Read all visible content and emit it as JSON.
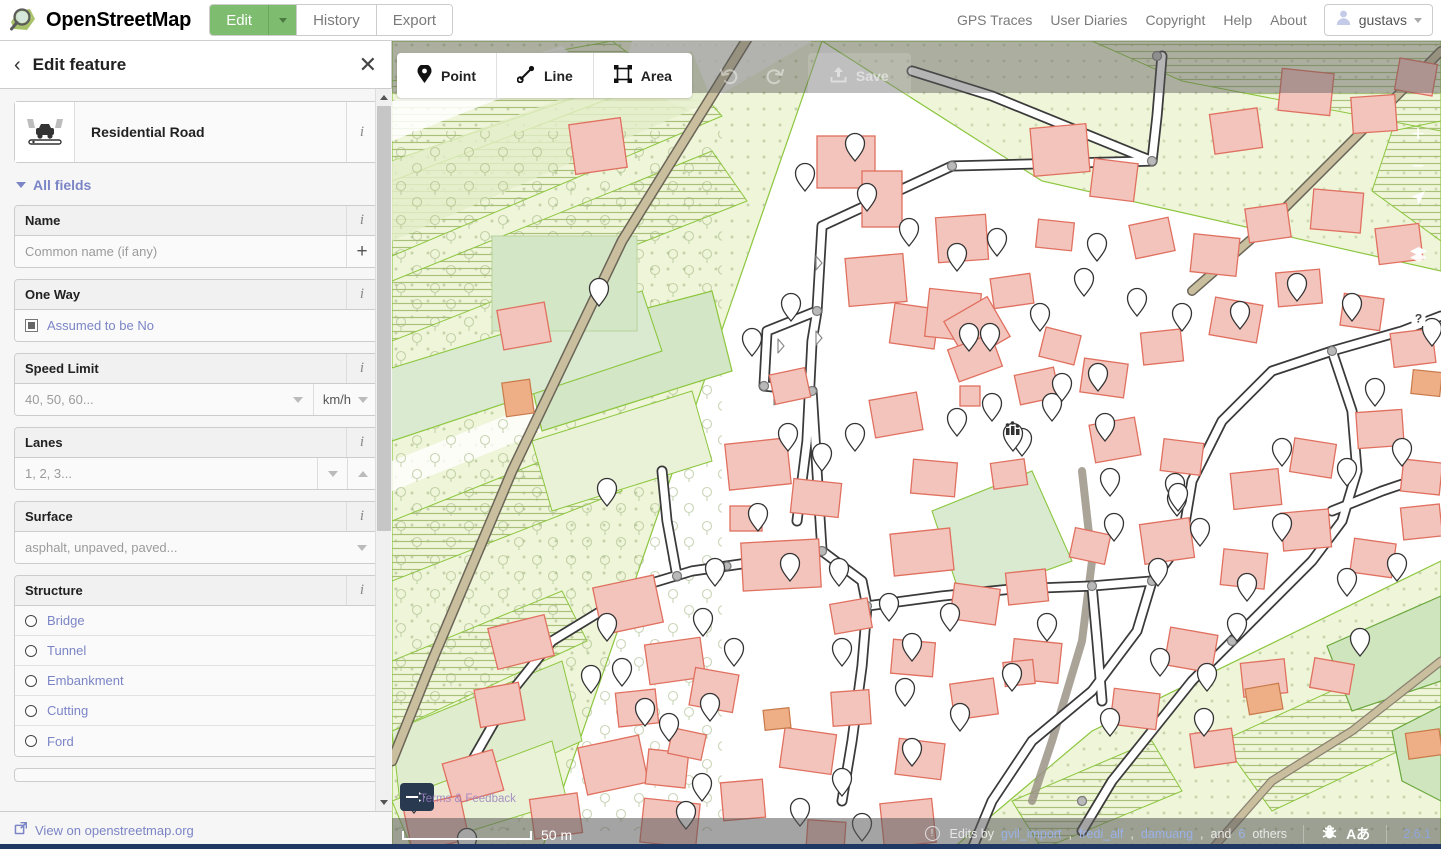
{
  "header": {
    "brand": "OpenStreetMap",
    "logo_icon": "magnifier-map-logo-icon",
    "nav": [
      {
        "label": "Edit",
        "active": true,
        "name": "edit"
      },
      {
        "label": "History",
        "active": false,
        "name": "history"
      },
      {
        "label": "Export",
        "active": false,
        "name": "export"
      }
    ],
    "edit_caret_icon": "chevron-down-icon",
    "links": [
      {
        "label": "GPS Traces",
        "name": "gps-traces"
      },
      {
        "label": "User Diaries",
        "name": "user-diaries"
      },
      {
        "label": "Copyright",
        "name": "copyright"
      },
      {
        "label": "Help",
        "name": "help"
      },
      {
        "label": "About",
        "name": "about"
      }
    ],
    "user": {
      "name": "gustavs",
      "avatar_icon": "user-avatar-icon",
      "caret_icon": "chevron-down-icon"
    }
  },
  "sidebar": {
    "back_icon": "chevron-left-icon",
    "title": "Edit feature",
    "close_icon": "close-icon",
    "feature": {
      "type_label": "Residential Road",
      "icon": "residential-road-icon",
      "info_icon": "i"
    },
    "all_fields_label": "All fields",
    "all_fields_caret_icon": "chevron-down-icon",
    "fields": [
      {
        "name": "name",
        "label": "Name",
        "info_icon": "i",
        "kind": "text-plus",
        "value": "",
        "placeholder": "Common name (if any)",
        "add_icon": "plus-icon"
      },
      {
        "name": "oneway",
        "label": "One Way",
        "info_icon": "i",
        "kind": "tristate",
        "state_label": "Assumed to be No",
        "checkbox_icon": "indeterminate-checkbox-icon"
      },
      {
        "name": "maxspeed",
        "label": "Speed Limit",
        "info_icon": "i",
        "kind": "combo-unit",
        "value": "",
        "placeholder": "40, 50, 60...",
        "unit": "km/h",
        "caret_icon": "chevron-down-icon"
      },
      {
        "name": "lanes",
        "label": "Lanes",
        "info_icon": "i",
        "kind": "combo-stepper",
        "value": "",
        "placeholder": "1, 2, 3...",
        "caret_icon": "chevron-down-icon",
        "stepper_icon": "chevron-up-icon"
      },
      {
        "name": "surface",
        "label": "Surface",
        "info_icon": "i",
        "kind": "combo",
        "value": "",
        "placeholder": "asphalt, unpaved, paved...",
        "caret_icon": "chevron-down-icon"
      },
      {
        "name": "structure",
        "label": "Structure",
        "info_icon": "i",
        "kind": "radios",
        "options": [
          {
            "label": "Bridge",
            "selected": false
          },
          {
            "label": "Tunnel",
            "selected": false
          },
          {
            "label": "Embankment",
            "selected": false
          },
          {
            "label": "Cutting",
            "selected": false
          },
          {
            "label": "Ford",
            "selected": false
          }
        ]
      }
    ],
    "footer": {
      "link_label": "View on openstreetmap.org",
      "link_icon": "external-link-icon"
    },
    "scrollbar": {
      "up_icon": "scroll-up-arrow-icon",
      "down_icon": "scroll-down-arrow-icon"
    }
  },
  "map_toolbar": {
    "draw_modes": [
      {
        "label": "Point",
        "icon": "map-pin-icon",
        "name": "point"
      },
      {
        "label": "Line",
        "icon": "line-icon",
        "name": "line"
      },
      {
        "label": "Area",
        "icon": "area-icon",
        "name": "area"
      }
    ],
    "undo": {
      "label": "Undo",
      "icon": "undo-arrow-icon",
      "disabled": true
    },
    "redo": {
      "label": "Redo",
      "icon": "redo-arrow-icon",
      "disabled": true
    },
    "save": {
      "label": "Save",
      "icon": "save-upload-icon",
      "disabled": true
    }
  },
  "map_controls": [
    {
      "name": "zoom-in",
      "label": "+",
      "icon": "plus-icon"
    },
    {
      "name": "zoom-out",
      "label": "−",
      "icon": "minus-icon"
    },
    {
      "name": "geolocate",
      "label": "",
      "icon": "location-arrow-icon"
    },
    {
      "name": "background-layers",
      "label": "",
      "icon": "layers-stack-icon"
    },
    {
      "name": "map-data",
      "label": "",
      "icon": "map-data-icon"
    },
    {
      "name": "help",
      "label": "?",
      "icon": "help-question-icon"
    }
  ],
  "map_footer": {
    "scale_label": "50 m",
    "terms_label": "Terms & Feedback",
    "mapbox_icon": "mapbox-logo-icon",
    "issues_icon": "alert-circle-icon",
    "edits_prefix": "Edits by",
    "editors": [
      "gvil_import",
      "fredi_alf",
      "damuang"
    ],
    "editors_suffix_count": "6",
    "editors_suffix": "others",
    "and_label": "and",
    "bug_icon": "bug-report-icon",
    "language_label": "Aあ",
    "version": "2.6.1"
  },
  "colors": {
    "brand_green": "#7ebc6f",
    "link_blue": "#7b85c6",
    "building_fill": "#f3c4bc",
    "building_stroke": "#e0705f",
    "landuse_green": "#eef5d8",
    "landuse_stroke": "#8cc63e",
    "road_white": "#ffffff",
    "road_casing": "#3a3a3a",
    "track_tan": "#c9bf9e",
    "grass_green": "#d9ead0",
    "bottom_strip": "#1f3864"
  }
}
